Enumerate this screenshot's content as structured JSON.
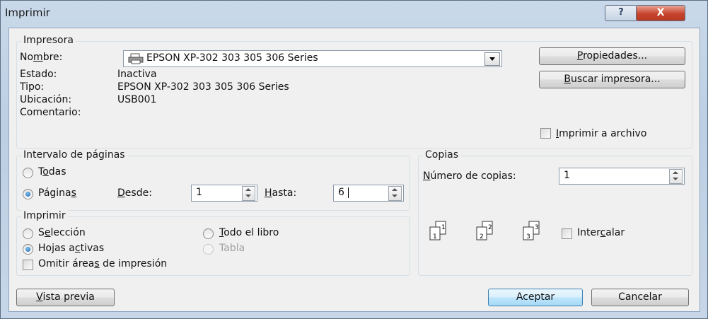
{
  "window": {
    "title": "Imprimir",
    "help_glyph": "?",
    "close_glyph": "X"
  },
  "printer": {
    "group_title": "Impresora",
    "name_label_pre": "No",
    "name_label_u": "m",
    "name_label_post": "bre:",
    "name_value": "EPSON XP-302 303 305 306 Series",
    "status_label": "Estado:",
    "status_value": "Inactiva",
    "type_label": "Tipo:",
    "type_value": "EPSON XP-302 303 305 306 Series",
    "location_label": "Ubicación:",
    "location_value": "USB001",
    "comment_label": "Comentario:",
    "properties_u": "P",
    "properties_rest": "ropiedades...",
    "find_u": "B",
    "find_rest": "uscar impresora...",
    "print_to_file_u": "I",
    "print_to_file_rest": "mprimir a archivo"
  },
  "range": {
    "group_title": "Intervalo de páginas",
    "all_pre": "T",
    "all_u": "o",
    "all_post": "das",
    "pages_pre": "Página",
    "pages_u": "s",
    "from_u": "D",
    "from_rest": "esde:",
    "from_value": "1",
    "to_u": "H",
    "to_rest": "asta:",
    "to_value": "6"
  },
  "print_what": {
    "group_title": "Imprimir",
    "selection_pre": "S",
    "selection_u": "e",
    "selection_post": "lección",
    "whole_book_u": "T",
    "whole_book_rest": "odo el libro",
    "active_sheets_pre": "Hojas a",
    "active_sheets_u": "c",
    "active_sheets_post": "tivas",
    "table": "Tabla",
    "ignore_areas_pre": "Omitir área",
    "ignore_areas_u": "s",
    "ignore_areas_post": " de impresión"
  },
  "copies": {
    "group_title": "Copias",
    "number_u": "N",
    "number_rest": "úmero de copias:",
    "number_value": "1",
    "collate_pre": "Inter",
    "collate_u": "c",
    "collate_post": "alar",
    "collate_pages": [
      {
        "back": "1",
        "front": "1"
      },
      {
        "back": "2",
        "front": "2"
      },
      {
        "back": "3",
        "front": "3"
      }
    ]
  },
  "footer": {
    "preview_u": "V",
    "preview_rest": "ista previa",
    "ok": "Aceptar",
    "cancel": "Cancelar"
  },
  "colors": {
    "title_bar": "#c9d9ea",
    "client_bg": "#f0f0f0",
    "close_button": "#c7432c",
    "default_button_border": "#3c7fb1"
  }
}
